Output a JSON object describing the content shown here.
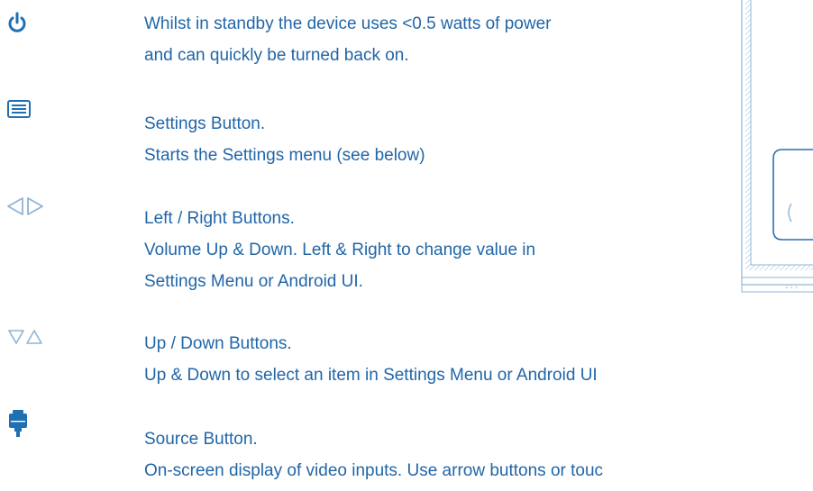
{
  "items": [
    {
      "icon": "power-icon",
      "lines": [
        "Whilst in standby the device uses <0.5 watts of power",
        "and can quickly be turned back on."
      ]
    },
    {
      "icon": "settings-menu-icon",
      "lines": [
        "Settings Button.",
        "Starts the Settings menu (see below)"
      ]
    },
    {
      "icon": "left-right-arrows-icon",
      "lines": [
        "Left / Right Buttons.",
        "Volume Up & Down.  Left & Right to change value in",
        "Settings Menu or Android UI."
      ]
    },
    {
      "icon": "down-up-arrows-icon",
      "lines": [
        "Up / Down Buttons.",
        "Up & Down to select an item in Settings Menu or Android UI"
      ]
    },
    {
      "icon": "source-icon",
      "lines": [
        "Source Button.",
        "On-screen display of video inputs.  Use arrow buttons or touc"
      ]
    }
  ],
  "colors": {
    "text": "#2166a8",
    "icon_dark": "#1f6fb3",
    "icon_light": "#8fb4d6"
  }
}
